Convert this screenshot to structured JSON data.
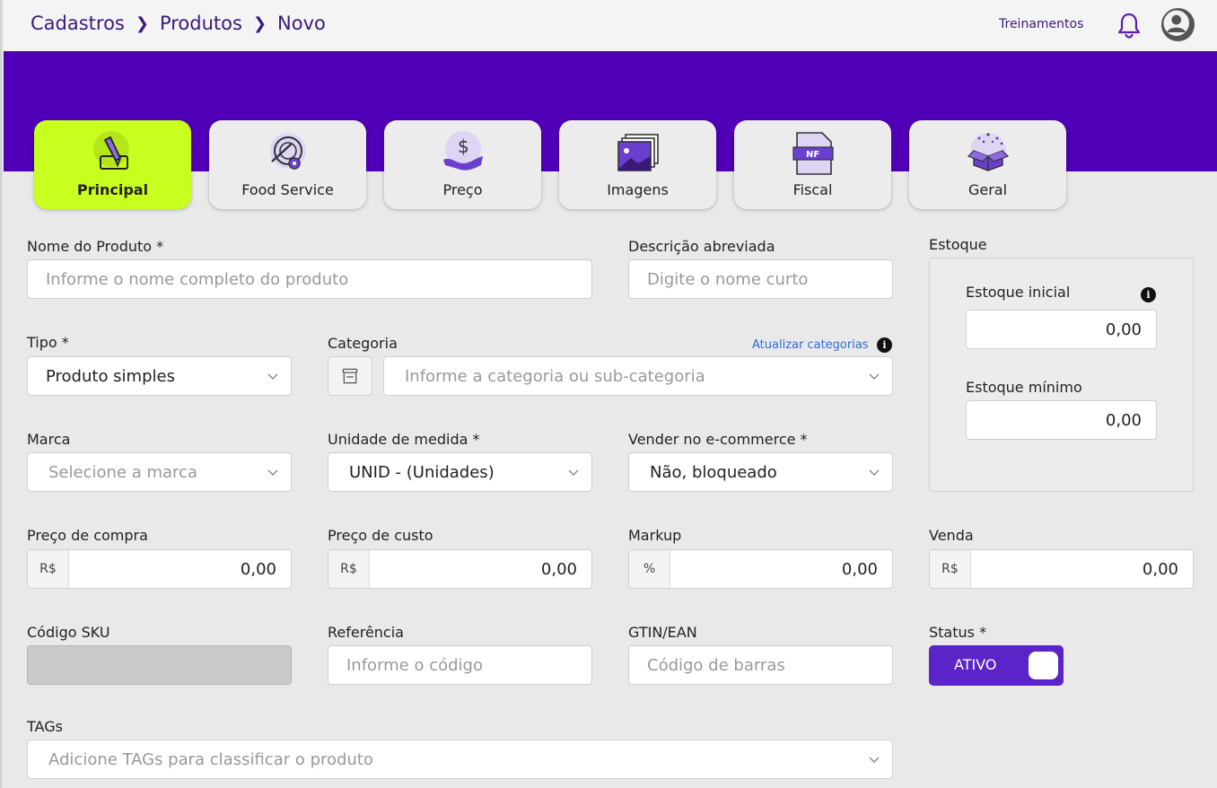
{
  "breadcrumb": [
    "Cadastros",
    "Produtos",
    "Novo"
  ],
  "header": {
    "trainings": "Treinamentos"
  },
  "tabs": [
    {
      "label": "Principal",
      "icon": "pencil-icon",
      "active": true
    },
    {
      "label": "Food Service",
      "icon": "plate-gear-icon",
      "active": false
    },
    {
      "label": "Preço",
      "icon": "money-hand-icon",
      "active": false
    },
    {
      "label": "Imagens",
      "icon": "images-icon",
      "active": false
    },
    {
      "label": "Fiscal",
      "icon": "invoice-icon",
      "active": false
    },
    {
      "label": "Geral",
      "icon": "box-icon",
      "active": false
    }
  ],
  "form": {
    "product_name": {
      "label": "Nome do Produto *",
      "placeholder": "Informe o nome completo do produto"
    },
    "short_desc": {
      "label": "Descrição abreviada",
      "placeholder": "Digite o nome curto"
    },
    "type": {
      "label": "Tipo *",
      "value": "Produto simples"
    },
    "category": {
      "label": "Categoria",
      "placeholder": "Informe a categoria ou sub-categoria",
      "update_link": "Atualizar categorias"
    },
    "brand": {
      "label": "Marca",
      "placeholder": "Selecione a marca"
    },
    "unit": {
      "label": "Unidade de medida *",
      "value": "UNID - (Unidades)"
    },
    "ecommerce": {
      "label": "Vender no e-commerce *",
      "value": "Não, bloqueado"
    },
    "purchase_price": {
      "label": "Preço de compra",
      "prefix": "R$",
      "value": "0,00"
    },
    "cost_price": {
      "label": "Preço de custo",
      "prefix": "R$",
      "value": "0,00"
    },
    "markup": {
      "label": "Markup",
      "prefix": "%",
      "value": "0,00"
    },
    "sale": {
      "label": "Venda",
      "prefix": "R$",
      "value": "0,00"
    },
    "sku": {
      "label": "Código SKU"
    },
    "reference": {
      "label": "Referência",
      "placeholder": "Informe o código"
    },
    "gtin": {
      "label": "GTIN/EAN",
      "placeholder": "Código de barras"
    },
    "status": {
      "label": "Status *",
      "value": "ATIVO"
    },
    "tags": {
      "label": "TAGs",
      "placeholder": "Adicione TAGs para classificar o produto"
    }
  },
  "stock": {
    "title": "Estoque",
    "initial": {
      "label": "Estoque inicial",
      "value": "0,00"
    },
    "minimum": {
      "label": "Estoque mínimo",
      "value": "0,00"
    }
  },
  "colors": {
    "brand": "#5000b6",
    "active_tab": "#c8ff1e",
    "toggle": "#5a24c8"
  }
}
